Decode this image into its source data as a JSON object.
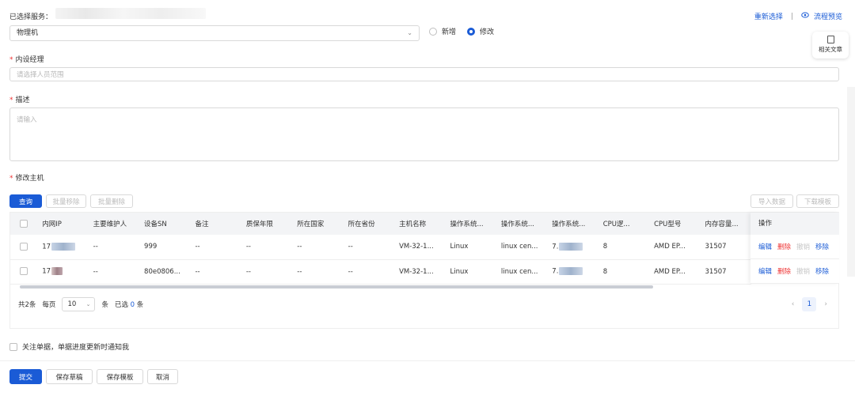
{
  "header": {
    "selected_service_label": "已选择服务：",
    "reselect": "重新选择",
    "separator": "|",
    "preview": "流程预览"
  },
  "form": {
    "type_select_value": "物理机",
    "radio_options": [
      {
        "label": "新增",
        "checked": false
      },
      {
        "label": "修改",
        "checked": true
      }
    ],
    "manager_label": "内设经理",
    "manager_placeholder": "请选择人员范围",
    "desc_label": "描述",
    "desc_placeholder": "请输入",
    "host_label": "修改主机",
    "required_mark": "*"
  },
  "related_doc": "相关文章",
  "toolbar": {
    "query": "查询",
    "batch_remove": "批量移除",
    "batch_delete": "批量删除",
    "import": "导入数据",
    "download_template": "下载模板"
  },
  "table": {
    "columns": [
      "内网IP",
      "主要维护人",
      "设备SN",
      "备注",
      "质保年限",
      "所在国家",
      "所在省份",
      "主机名称",
      "操作系统...",
      "操作系统...",
      "操作系统...",
      "CPU逻...",
      "CPU型号",
      "内存容量..."
    ],
    "op_header": "操作",
    "rows": [
      {
        "ip": "17",
        "maintainer": "--",
        "sn": "999",
        "remark": "--",
        "warranty": "--",
        "country": "--",
        "province": "--",
        "hostname": "VM-32-1...",
        "os1": "Linux",
        "os2": "linux cen...",
        "os3": "7.",
        "cpu_logic": "8",
        "cpu_model": "AMD EP...",
        "memory": "31507"
      },
      {
        "ip": "17",
        "maintainer": "--",
        "sn": "80e0806...",
        "remark": "--",
        "warranty": "--",
        "country": "--",
        "province": "--",
        "hostname": "VM-32-1...",
        "os1": "Linux",
        "os2": "linux cen...",
        "os3": "7.",
        "cpu_logic": "8",
        "cpu_model": "AMD EP...",
        "memory": "31507"
      }
    ],
    "ops": {
      "edit": "编辑",
      "delete": "删除",
      "undo": "撤销",
      "remove": "移除"
    }
  },
  "pagination": {
    "total": "共2条",
    "per_page_label": "每页",
    "page_size": "10",
    "unit": "条",
    "selected_prefix": "已选",
    "selected_count": "0",
    "selected_suffix": "条",
    "current_page": "1",
    "prev": "‹",
    "next": "›"
  },
  "notify_label": "关注单据，单据进度更新时通知我",
  "footer": {
    "submit": "提交",
    "save_draft": "保存草稿",
    "save_template": "保存模板",
    "cancel": "取消"
  },
  "colors": {
    "primary": "#1a5bd6",
    "danger": "#e33333",
    "disabled": "#c8c8c8"
  }
}
